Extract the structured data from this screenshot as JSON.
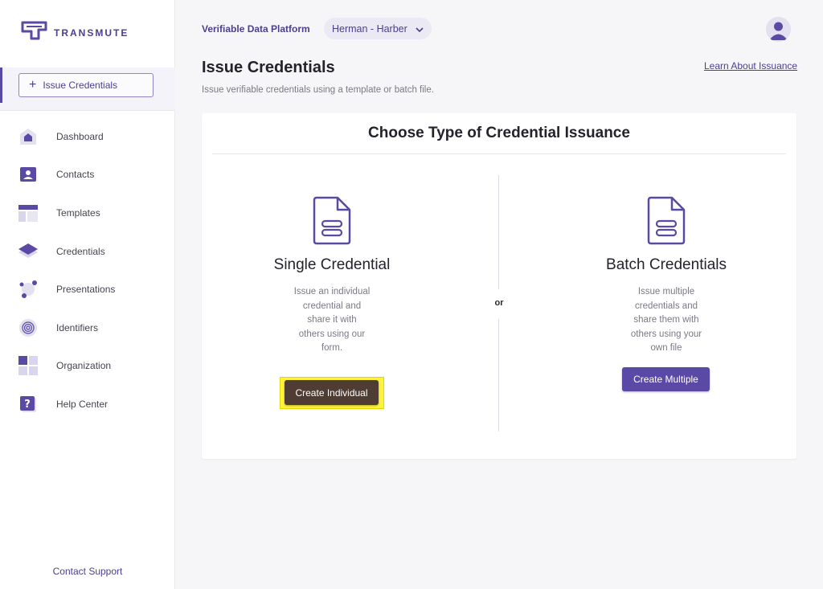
{
  "brand": {
    "name": "TRANSMUTE"
  },
  "sidebar": {
    "issue_button_label": "Issue Credentials",
    "items": [
      {
        "label": "Dashboard",
        "icon": "home-icon"
      },
      {
        "label": "Contacts",
        "icon": "contact-card-icon"
      },
      {
        "label": "Templates",
        "icon": "template-icon"
      },
      {
        "label": "Credentials",
        "icon": "credentials-icon"
      },
      {
        "label": "Presentations",
        "icon": "presentations-icon"
      },
      {
        "label": "Identifiers",
        "icon": "fingerprint-icon"
      },
      {
        "label": "Organization",
        "icon": "organization-icon"
      },
      {
        "label": "Help Center",
        "icon": "help-icon"
      }
    ],
    "contact_support": "Contact Support"
  },
  "topbar": {
    "platform_title": "Verifiable Data Platform",
    "org_selected": "Herman - Harber"
  },
  "page": {
    "title": "Issue Credentials",
    "subtitle": "Issue verifiable credentials using a template or batch file.",
    "learn_link": "Learn About Issuance"
  },
  "card": {
    "title": "Choose Type of Credential Issuance",
    "separator": "or",
    "single": {
      "title": "Single Credential",
      "description": "Issue an individual credential and share it with others using our form.",
      "button": "Create Individual"
    },
    "batch": {
      "title": "Batch Credentials",
      "description": "Issue multiple credentials and share them with others using your own file",
      "button": "Create Multiple"
    }
  },
  "colors": {
    "brand": "#5b4aa5",
    "brand_text": "#4b3f8e",
    "highlight": "#fff33b",
    "individual_button": "#4f3d33"
  }
}
